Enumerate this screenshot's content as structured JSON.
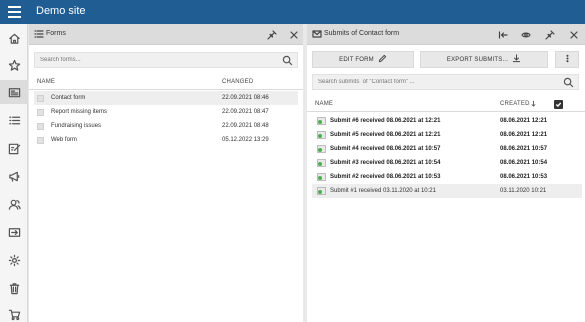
{
  "app": {
    "site_title": "Demo site"
  },
  "sidebar": {
    "items": [
      {
        "icon": "home-icon"
      },
      {
        "icon": "star-icon"
      },
      {
        "icon": "forms-icon",
        "active": true
      },
      {
        "icon": "list-icon"
      },
      {
        "icon": "edit-icon"
      },
      {
        "icon": "megaphone-icon"
      },
      {
        "icon": "users-icon"
      },
      {
        "icon": "export-icon"
      },
      {
        "icon": "gear-icon"
      },
      {
        "icon": "trash-icon"
      },
      {
        "icon": "cart-icon"
      }
    ]
  },
  "forms_panel": {
    "title": "Forms",
    "search_placeholder": "Search forms...",
    "columns": {
      "name": "NAME",
      "changed": "CHANGED"
    },
    "rows": [
      {
        "name": "Contact form",
        "changed": "22.09.2021 08:46",
        "selected": true
      },
      {
        "name": "Report missing items",
        "changed": "22.09.2021 08:47"
      },
      {
        "name": "Fundraising issues",
        "changed": "22.09.2021 08:48"
      },
      {
        "name": "Web form",
        "changed": "05.12.2022 13:29"
      }
    ]
  },
  "submits_panel": {
    "title": "Submits of Contact form",
    "edit_form_label": "EDIT FORM",
    "export_label": "EXPORT SUBMITS...",
    "search_placeholder": "Search submits  of \"Contact form\" ...",
    "columns": {
      "name": "NAME",
      "created": "CREATED"
    },
    "rows": [
      {
        "name": "Submit #6 received 08.06.2021 at 12:21",
        "created": "08.06.2021 12:21",
        "unread": true
      },
      {
        "name": "Submit #5 received 08.06.2021 at 12:21",
        "created": "08.06.2021 12:21",
        "unread": true
      },
      {
        "name": "Submit #4 received 08.06.2021 at 10:57",
        "created": "08.06.2021 10:57",
        "unread": true
      },
      {
        "name": "Submit #3 received 08.06.2021 at 10:54",
        "created": "08.06.2021 10:54",
        "unread": true
      },
      {
        "name": "Submit #2 received 08.06.2021 at 10:53",
        "created": "08.06.2021 10:53",
        "unread": true
      },
      {
        "name": "Submit #1 received 03.11.2020 at 10:21",
        "created": "03.11.2020 10:21",
        "unread": false,
        "selected": true
      }
    ]
  },
  "colors": {
    "topbar": "#1f5d92",
    "panel_header": "#dcdcdc",
    "submit_icon": "#4caf50"
  }
}
